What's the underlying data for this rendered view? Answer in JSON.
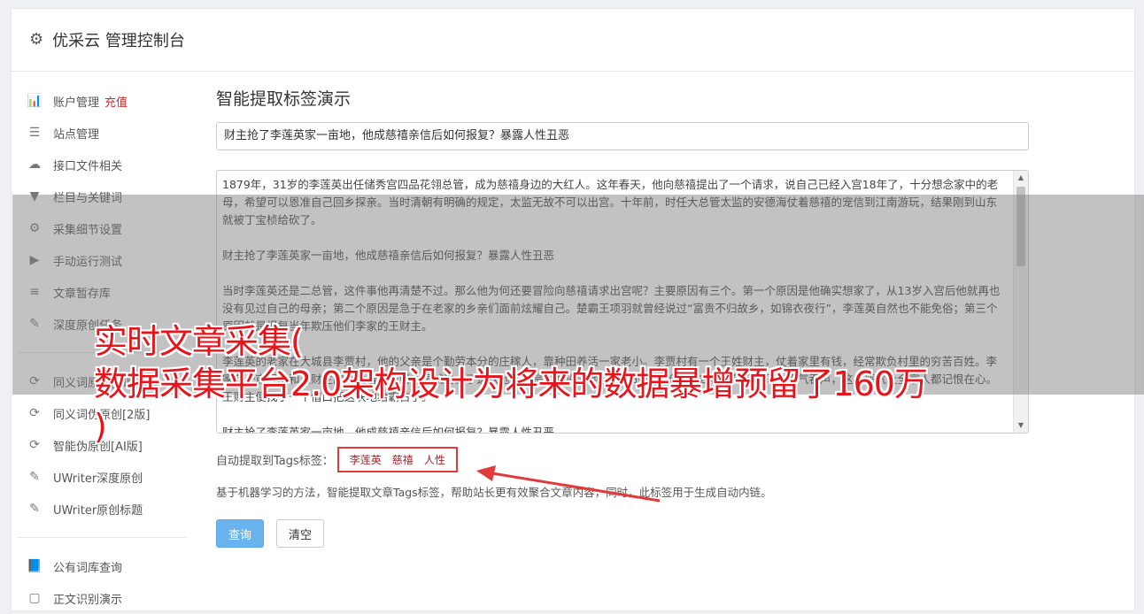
{
  "header": {
    "title": "优采云 管理控制台",
    "icon": "gear-icon"
  },
  "sidebar": {
    "group1": [
      {
        "label": "账户管理",
        "badge": "充值",
        "icon": "bar-chart-icon"
      },
      {
        "label": "站点管理",
        "icon": "server-icon"
      },
      {
        "label": "接口文件相关",
        "icon": "cloud-upload-icon"
      },
      {
        "label": "栏目与关键词",
        "icon": "filter-icon"
      },
      {
        "label": "采集细节设置",
        "icon": "cogs-icon"
      },
      {
        "label": "手动运行测试",
        "icon": "play-circle-icon"
      },
      {
        "label": "文章暂存库",
        "icon": "database-icon"
      },
      {
        "label": "深度原创任务",
        "icon": "edit-icon"
      }
    ],
    "group2": [
      {
        "label": "同义词原创[AI版]",
        "icon": "refresh-icon"
      },
      {
        "label": "同义词伪原创[2版]",
        "icon": "refresh-icon"
      },
      {
        "label": "智能伪原创[AI版]",
        "icon": "refresh-icon"
      },
      {
        "label": "UWriter深度原创",
        "icon": "edit-icon"
      },
      {
        "label": "UWriter原创标题",
        "icon": "edit-icon"
      }
    ],
    "group3": [
      {
        "label": "公有词库查询",
        "icon": "book-icon"
      },
      {
        "label": "正文识别演示",
        "icon": "square-icon"
      }
    ]
  },
  "main": {
    "heading": "智能提取标签演示",
    "title_value": "财主抢了李莲英家一亩地，他成慈禧亲信后如何报复？暴露人性丑恶",
    "content_paragraphs": [
      "1879年，31岁的李莲英出任储秀宫四品花翎总管，成为慈禧身边的大红人。这年春天，他向慈禧提出了一个请求，说自己已经入宫18年了，十分想念家中的老母，希望可以恩准自己回乡探亲。当时清朝有明确的规定，太监无故不可以出宫。十年前，时任大总管太监的安德海仗着慈禧的宠信到江南游玩，结果刚到山东就被丁宝桢给砍了。",
      "财主抢了李莲英家一亩地，他成慈禧亲信后如何报复？暴露人性丑恶",
      "当时李莲英还是二总管，这件事他再清楚不过。那么他为何还要冒险向慈禧请求出宫呢？主要原因有三个。第一个原因是他确实想家了，从13岁入宫后他就再也没有见过自己的母亲；第二个原因是急于在老家的乡亲们面前炫耀自己。楚霸王项羽就曾经说过“富贵不归故乡，如锦衣夜行”，李莲英自然也不能免俗；第三个原因就是报复当年欺压他们李家的王财主。",
      "李莲英的老家在大城县李贾村，他的父亲是个勤劳本分的庄稼人，靠种田养活一家老小。李贾村有一个王姓财主，仗着家里有钱，经常欺负村里的穷苦百姓。李家有一亩好地和王财主的地挨着，王财主早就看上了这块地，于是想方设法地把李家的地给抢了过去，李父无奈只能忍气吞声，这口恶气让全家人都记恨在心。王财主便找了一个借口把这块地给霸占了。",
      "财主抢了李莲英家一亩地，他成慈禧亲信后如何报复？暴露人性丑恶"
    ],
    "tags_label": "自动提取到Tags标签：",
    "tags": [
      "李莲英",
      "慈禧",
      "人性"
    ],
    "description": "基于机器学习的方法，智能提取文章Tags标签，帮助站长更有效聚合文章内容，同时，此标签用于生成自动内链。",
    "query_button": "查询",
    "clear_button": "清空"
  },
  "overlay": {
    "line1": "实时文章采集(",
    "line2": "数据采集平台2.0架构设计为将来的数据暴增预留了160万",
    "line3": ")"
  },
  "colors": {
    "accent_red": "#e8141b",
    "primary_blue": "#69b3ef",
    "tag_red": "#a3232a"
  }
}
